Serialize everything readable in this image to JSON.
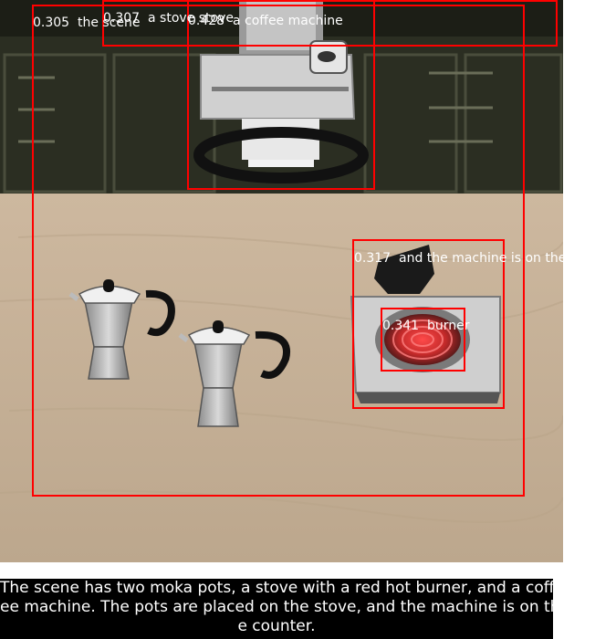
{
  "detections": [
    {
      "score": "0.305",
      "label": "the scene"
    },
    {
      "score": "0.307",
      "label": "a stove stove"
    },
    {
      "score": "0.428",
      "label": "a coffee machine"
    },
    {
      "score": "0.317",
      "label": "and the machine is on the"
    },
    {
      "score": "0.341",
      "label": "burner"
    }
  ],
  "caption_lines": [
    "The scene has two moka pots, a stove with a red hot burner, and a coff",
    "ee machine. The pots are placed on the stove, and the machine is on th",
    "e counter."
  ],
  "colors": {
    "box": "#ff0000",
    "caption_bg": "#000000",
    "caption_text": "#ffffff",
    "counter": "#c8b49a",
    "cabinet": "#2b2e22"
  }
}
